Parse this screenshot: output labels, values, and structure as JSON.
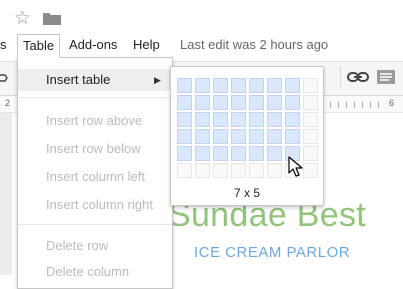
{
  "header": {
    "star_icon": "star-icon",
    "folder_icon": "folder-icon"
  },
  "menubar": {
    "items": [
      {
        "label": "s"
      },
      {
        "label": "Table"
      },
      {
        "label": "Add-ons"
      },
      {
        "label": "Help"
      }
    ],
    "last_edit": "Last edit was 2 hours ago"
  },
  "ruler": {
    "left_number": "2",
    "right_number": "6"
  },
  "table_menu": {
    "items": [
      {
        "label": "Insert table",
        "enabled": true,
        "has_submenu": true
      },
      {
        "label": "Insert row above",
        "enabled": false
      },
      {
        "label": "Insert row below",
        "enabled": false
      },
      {
        "label": "Insert column left",
        "enabled": false
      },
      {
        "label": "Insert column right",
        "enabled": false
      },
      {
        "label": "Delete row",
        "enabled": false
      },
      {
        "label": "Delete column",
        "enabled": false
      }
    ]
  },
  "table_grid": {
    "size_label": "7 x 5",
    "selected_cols": 7,
    "selected_rows": 5,
    "total_cols": 8,
    "total_rows": 6
  },
  "document": {
    "title": "Sundae Best",
    "subtitle": "ICE CREAM PARLOR"
  },
  "colors": {
    "title": "#93c47d",
    "subtitle": "#6fa8dc",
    "grid_selected": "#dbe7fb"
  }
}
